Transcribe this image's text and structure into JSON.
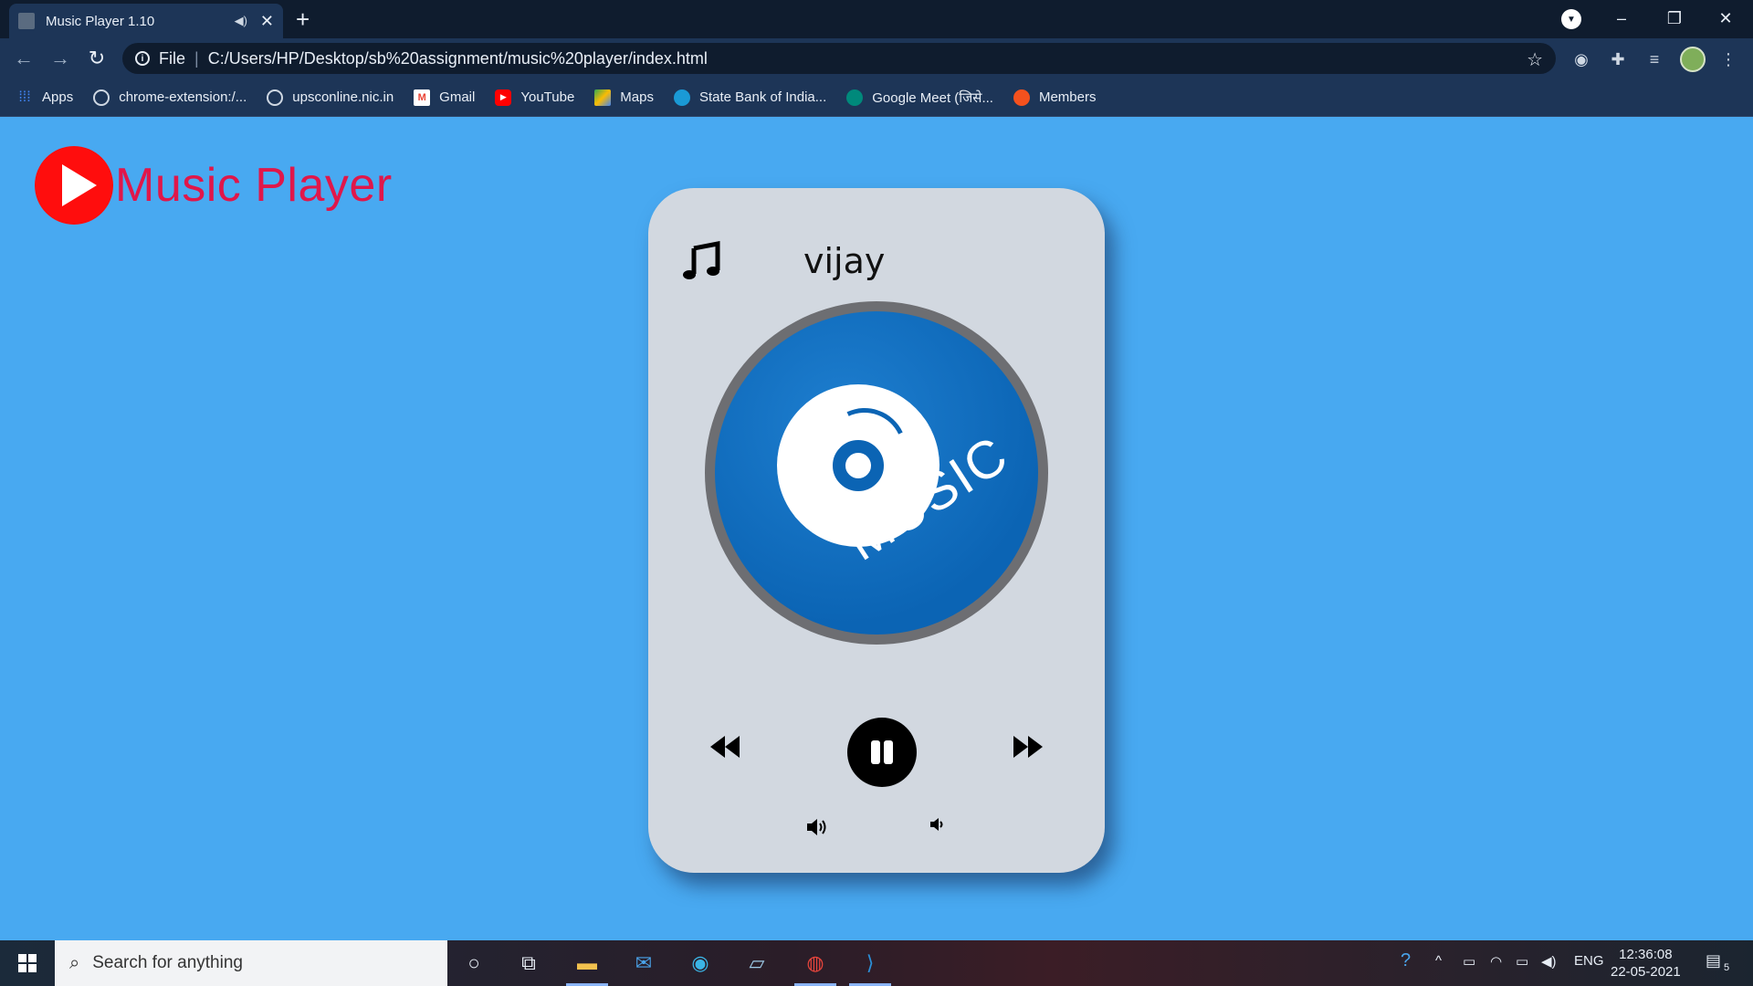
{
  "browser": {
    "tab_title": "Music Player 1.10",
    "tab_audio_icon": "speaker-icon",
    "tab_close": "✕",
    "new_tab": "+",
    "address": {
      "scheme_label": "File",
      "url": "C:/Users/HP/Desktop/sb%20assignment/music%20player/index.html"
    },
    "bookmarks": [
      {
        "label": "Apps",
        "icon": "apps-grid-icon",
        "color": "#4285f4"
      },
      {
        "label": "chrome-extension:/...",
        "icon": "globe-icon",
        "color": "#cfd8e3"
      },
      {
        "label": "upsconline.nic.in",
        "icon": "globe-icon",
        "color": "#cfd8e3"
      },
      {
        "label": "Gmail",
        "icon": "gmail-icon",
        "color": "#ea4335"
      },
      {
        "label": "YouTube",
        "icon": "youtube-icon",
        "color": "#ff0000"
      },
      {
        "label": "Maps",
        "icon": "maps-icon",
        "color": "#34a853"
      },
      {
        "label": "State Bank of India...",
        "icon": "sbi-icon",
        "color": "#1a9ad6"
      },
      {
        "label": "Google Meet (जिसे...",
        "icon": "meet-icon",
        "color": "#00897b"
      },
      {
        "label": "Members",
        "icon": "members-icon",
        "color": "#f4511e"
      }
    ]
  },
  "page": {
    "logo_text": "Music Player",
    "song_title": "vijay",
    "disc_label": "MUSIC",
    "colors": {
      "background": "#48a9f1",
      "logo_red": "#ff0d0d",
      "logo_text": "#e0174a",
      "card": "#d2d8e0",
      "disc_blue": "#0b64b4"
    }
  },
  "taskbar": {
    "search_placeholder": "Search for anything",
    "tray_lang": "ENG",
    "time": "12:36:08",
    "date": "22-05-2021",
    "notifications": "5"
  }
}
